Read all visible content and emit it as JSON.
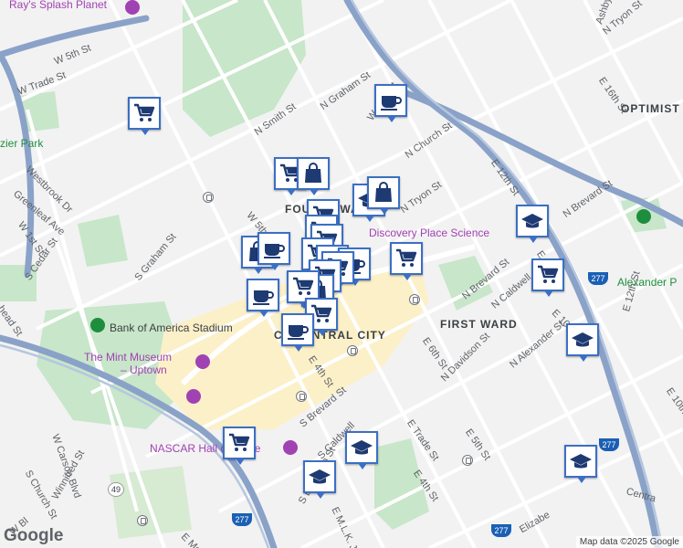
{
  "map": {
    "attribution": "Map data ©2025 Google",
    "logo": "Google",
    "colors": {
      "marker_border": "#3b6fc4",
      "marker_icon": "#1e3a73",
      "highway": "#8aa2c8",
      "park": "#c8e6c9",
      "uptown": "#fcf0c8"
    }
  },
  "labels": {
    "rays": "Ray's Splash Planet",
    "w5th_a": "W 5th St",
    "w_trade": "W Trade St",
    "frazier": "zier Park",
    "westbrook": "Westbrook Dr",
    "greenleaf": "Greenleaf Ave",
    "w1st": "W 1st St",
    "s_cedar": "S Cedar St",
    "s_church_top": "head St",
    "n_smith": "N Smith St",
    "n_graham": "N Graham St",
    "w10th": "W 10th St",
    "n_church": "N Church St",
    "w5th_b": "W 5th St",
    "s_graham": "S Graham St",
    "fourth_ward": "FOURTH WARD",
    "n_tryon_a": "N Tryon St",
    "discovery": "Discovery Place Science",
    "e12th_a": "E 12th St",
    "e16th": "E 16th St",
    "n_tryon_b": "N Tryon St",
    "ashby": "Ashby",
    "optimist": "OPTIMIST",
    "n_brevard_a": "N Brevard St",
    "e11th": "E 11th St",
    "n_caldwell_a": "N Caldwell",
    "alexander": "Alexander P",
    "e12th_b": "E 12th St",
    "first_ward": "FIRST WARD",
    "n_brevard_b": "N Brevard St",
    "e10th": "E 10th S",
    "boa": "Bank of America Stadium",
    "central_city": "CE CENTRAL CITY",
    "e6th": "E 6th St",
    "n_davidson": "N Davidson St",
    "n_alexander": "N Alexander St",
    "mint": "The Mint Museum",
    "mint2": "– Uptown",
    "e4th_a": "E 4th St",
    "s_brevard": "S Brevard St",
    "e_trade": "E Trade St",
    "e5th": "E 5th St",
    "e10th_b": "E 10th",
    "w_carson": "W Carson Blvd",
    "nascar": "NASCAR Hall of Fame",
    "s_caldwell": "S Caldwell",
    "e4th_b": "E 4th St",
    "central": "Centra",
    "s_church": "S Church St",
    "winnifred": "Winnifred St",
    "s_davidson": "S Davidson St",
    "mlk": "E M.L.K. Jr Blvd",
    "w_bland": "W Bl",
    "e_mo": "E Mo",
    "elizabeth": "Elizabe"
  },
  "shields": {
    "i277_a": "277",
    "i277_b": "277",
    "i277_c": "277",
    "i277_d": "277",
    "i277_e": "277",
    "nc49": "49"
  },
  "markers": [
    {
      "type": "grocery",
      "icon": "cart-icon"
    },
    {
      "type": "grocery",
      "icon": "cart-icon"
    },
    {
      "type": "shop",
      "icon": "shopping-bag-icon"
    },
    {
      "type": "cafe",
      "icon": "coffee-cup-icon"
    },
    {
      "type": "school",
      "icon": "graduation-cap-icon"
    },
    {
      "type": "shop",
      "icon": "shopping-bag-icon"
    },
    {
      "type": "grocery",
      "icon": "cart-icon"
    },
    {
      "type": "grocery",
      "icon": "cart-icon"
    },
    {
      "type": "grocery",
      "icon": "cart-icon"
    },
    {
      "type": "shop",
      "icon": "shopping-bag-icon"
    },
    {
      "type": "cafe",
      "icon": "coffee-cup-icon"
    },
    {
      "type": "grocery",
      "icon": "cart-icon"
    },
    {
      "type": "grocery",
      "icon": "cart-icon"
    },
    {
      "type": "cafe",
      "icon": "coffee-cup-icon"
    },
    {
      "type": "grocery",
      "icon": "cart-icon"
    },
    {
      "type": "grocery",
      "icon": "cart-icon"
    },
    {
      "type": "school",
      "icon": "graduation-cap-icon"
    },
    {
      "type": "grocery",
      "icon": "cart-icon"
    },
    {
      "type": "shop",
      "icon": "shopping-bag-icon"
    },
    {
      "type": "cafe",
      "icon": "coffee-cup-icon"
    },
    {
      "type": "grocery",
      "icon": "cart-icon"
    },
    {
      "type": "grocery",
      "icon": "cart-icon"
    },
    {
      "type": "cafe",
      "icon": "coffee-cup-icon"
    },
    {
      "type": "grocery",
      "icon": "cart-icon"
    },
    {
      "type": "school",
      "icon": "graduation-cap-icon"
    },
    {
      "type": "school",
      "icon": "graduation-cap-icon"
    },
    {
      "type": "school",
      "icon": "graduation-cap-icon"
    },
    {
      "type": "school",
      "icon": "graduation-cap-icon"
    },
    {
      "type": "grocery",
      "icon": "cart-icon"
    }
  ]
}
